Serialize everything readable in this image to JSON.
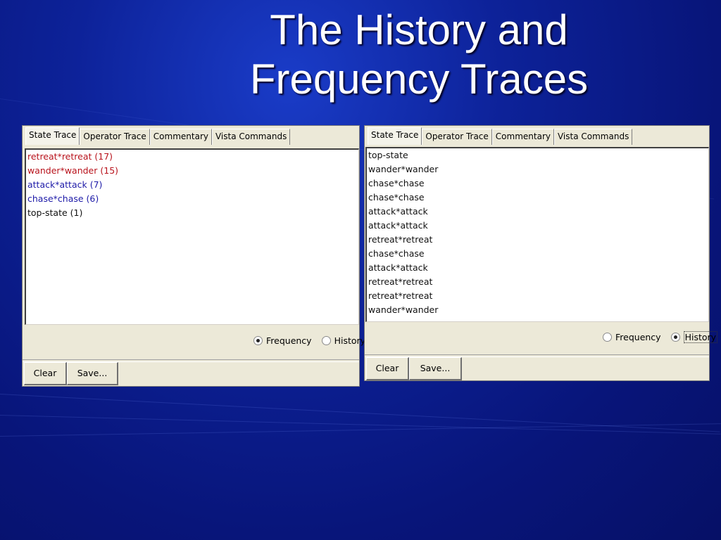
{
  "slide": {
    "title_line1": "The History and",
    "title_line2": "Frequency Traces"
  },
  "left_panel": {
    "tabs": [
      "State Trace",
      "Operator Trace",
      "Commentary",
      "Vista Commands"
    ],
    "active_tab": "State Trace",
    "entries": [
      {
        "text": "retreat*retreat (17)",
        "color": "#b8121b"
      },
      {
        "text": "wander*wander (15)",
        "color": "#b8121b"
      },
      {
        "text": "attack*attack (7)",
        "color": "#1d1aa8"
      },
      {
        "text": "chase*chase (6)",
        "color": "#1d1aa8"
      },
      {
        "text": "top-state (1)",
        "color": "#111111"
      }
    ],
    "radio": {
      "frequency_label": "Frequency",
      "history_label": "History",
      "selected": "Frequency"
    },
    "buttons": {
      "clear": "Clear",
      "save": "Save..."
    }
  },
  "right_panel": {
    "tabs": [
      "State Trace",
      "Operator Trace",
      "Commentary",
      "Vista Commands"
    ],
    "active_tab": "State Trace",
    "entries": [
      "top-state",
      "wander*wander",
      "chase*chase",
      "chase*chase",
      "attack*attack",
      "attack*attack",
      "retreat*retreat",
      "chase*chase",
      "attack*attack",
      "retreat*retreat",
      "retreat*retreat",
      "wander*wander"
    ],
    "radio": {
      "frequency_label": "Frequency",
      "history_label": "History",
      "selected": "History"
    },
    "buttons": {
      "clear": "Clear",
      "save": "Save..."
    }
  }
}
